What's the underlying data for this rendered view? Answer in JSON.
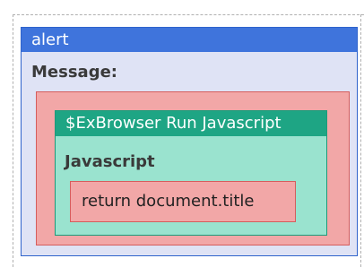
{
  "block": {
    "title": "alert",
    "message_label": "Message:"
  },
  "nested_block": {
    "title": "$ExBrowser Run Javascript",
    "param_label": "Javascript",
    "param_value": "return document.title"
  },
  "colors": {
    "alert_header": "#3f74dc",
    "alert_body": "#dfe3f5",
    "slot_fill": "#f2a7a7",
    "js_header": "#1ea584",
    "js_body": "#9ae3cf"
  }
}
